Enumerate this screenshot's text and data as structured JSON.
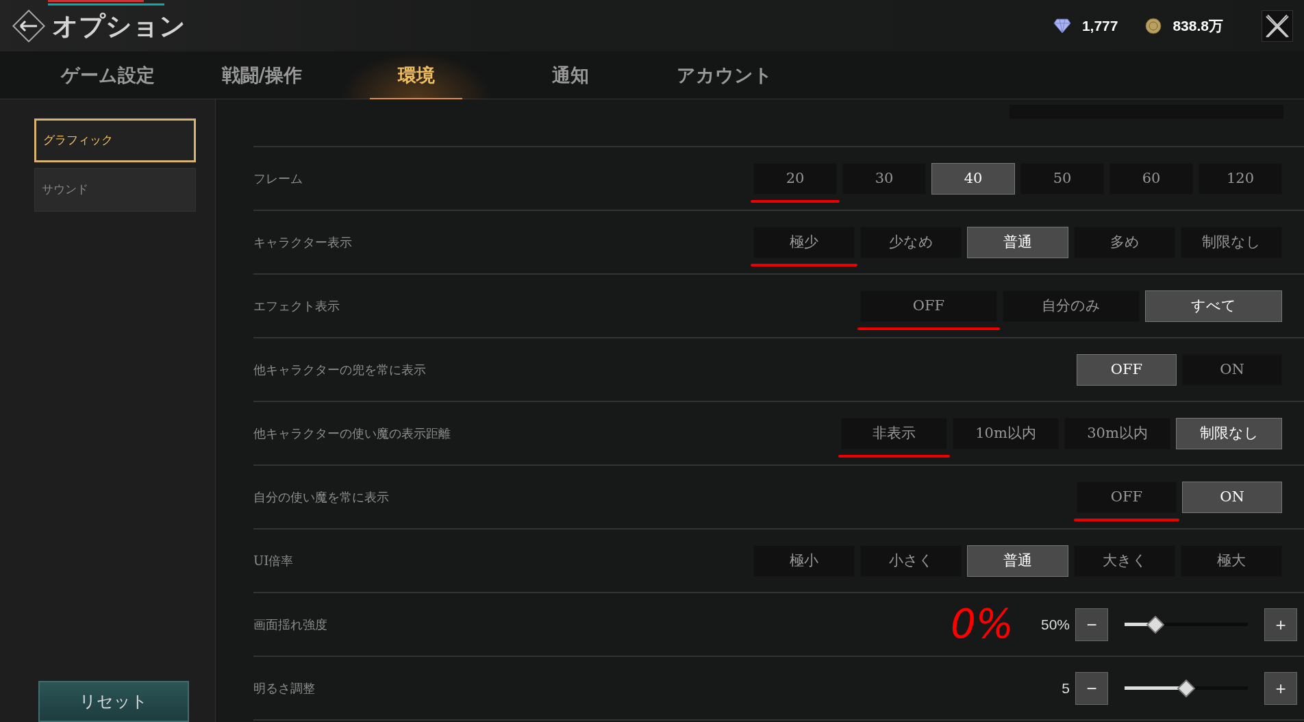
{
  "window": {
    "title": "オプション"
  },
  "currencies": [
    {
      "kind": "gem",
      "amount": "1,777"
    },
    {
      "kind": "coin",
      "amount": "838.8万"
    }
  ],
  "tabs": [
    {
      "label": "ゲーム設定",
      "selected": false
    },
    {
      "label": "戦闘/操作",
      "selected": false
    },
    {
      "label": "環境",
      "selected": true
    },
    {
      "label": "通知",
      "selected": false
    },
    {
      "label": "アカウント",
      "selected": false
    }
  ],
  "sidebar": {
    "items": [
      {
        "label": "グラフィック",
        "selected": true
      },
      {
        "label": "サウンド",
        "selected": false
      }
    ],
    "reset_button": "リセット"
  },
  "settings": [
    {
      "kind": "choice",
      "label": "フレーム",
      "options": [
        {
          "label": "20",
          "selected": false,
          "underlined": true
        },
        {
          "label": "30",
          "selected": false,
          "underlined": false
        },
        {
          "label": "40",
          "selected": true,
          "underlined": false
        },
        {
          "label": "50",
          "selected": false,
          "underlined": false
        },
        {
          "label": "60",
          "selected": false,
          "underlined": false
        },
        {
          "label": "120",
          "selected": false,
          "underlined": false
        }
      ]
    },
    {
      "kind": "choice",
      "label": "キャラクター表示",
      "options": [
        {
          "label": "極少",
          "selected": false,
          "underlined": true
        },
        {
          "label": "少なめ",
          "selected": false,
          "underlined": false
        },
        {
          "label": "普通",
          "selected": true,
          "underlined": false
        },
        {
          "label": "多め",
          "selected": false,
          "underlined": false
        },
        {
          "label": "制限なし",
          "selected": false,
          "underlined": false
        }
      ]
    },
    {
      "kind": "choice",
      "label": "エフェクト表示",
      "options": [
        {
          "label": "OFF",
          "selected": false,
          "underlined": true
        },
        {
          "label": "自分のみ",
          "selected": false,
          "underlined": false
        },
        {
          "label": "すべて",
          "selected": true,
          "underlined": false
        }
      ]
    },
    {
      "kind": "choice",
      "label": "他キャラクターの兜を常に表示",
      "options": [
        {
          "label": "OFF",
          "selected": true,
          "underlined": false
        },
        {
          "label": "ON",
          "selected": false,
          "underlined": false
        }
      ]
    },
    {
      "kind": "choice",
      "label": "他キャラクターの使い魔の表示距離",
      "options": [
        {
          "label": "非表示",
          "selected": false,
          "underlined": true
        },
        {
          "label": "10m以内",
          "selected": false,
          "underlined": false
        },
        {
          "label": "30m以内",
          "selected": false,
          "underlined": false
        },
        {
          "label": "制限なし",
          "selected": true,
          "underlined": false
        }
      ]
    },
    {
      "kind": "choice",
      "label": "自分の使い魔を常に表示",
      "options": [
        {
          "label": "OFF",
          "selected": false,
          "underlined": true
        },
        {
          "label": "ON",
          "selected": true,
          "underlined": false
        }
      ]
    },
    {
      "kind": "choice",
      "label": "UI倍率",
      "options": [
        {
          "label": "極小",
          "selected": false,
          "underlined": false
        },
        {
          "label": "小さく",
          "selected": false,
          "underlined": false
        },
        {
          "label": "普通",
          "selected": true,
          "underlined": false
        },
        {
          "label": "大きく",
          "selected": false,
          "underlined": false
        },
        {
          "label": "極大",
          "selected": false,
          "underlined": false
        }
      ]
    },
    {
      "kind": "slider",
      "label": "画面揺れ強度",
      "annotation": "0%",
      "reading": "50%",
      "level": 0.25,
      "minus": "−",
      "plus": "+"
    },
    {
      "kind": "slider",
      "label": "明るさ調整",
      "reading": "5",
      "level": 0.5,
      "minus": "−",
      "plus": "+"
    }
  ]
}
